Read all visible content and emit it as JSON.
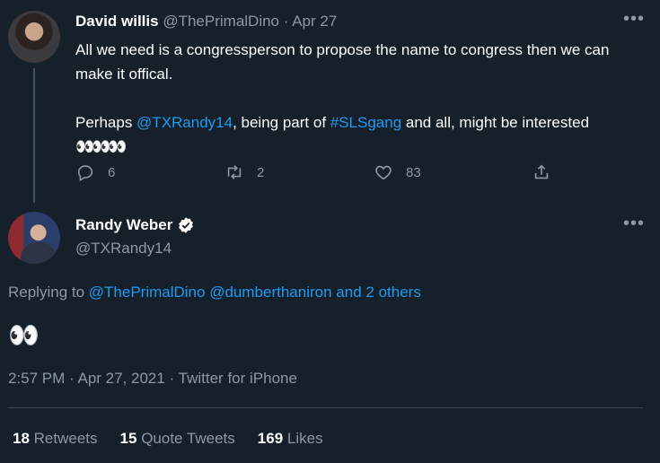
{
  "tweet1": {
    "display_name": "David willis",
    "handle": "@ThePrimalDino",
    "separator": "·",
    "date": "Apr 27",
    "line1": "All we need is a congressperson to propose the name to congress then we can make it offical.",
    "line2_pre": "Perhaps ",
    "line2_mention": "@TXRandy14",
    "line2_mid": ", being part of ",
    "line2_hashtag": "#SLSgang",
    "line2_post": " and all, might be interested",
    "emoji": "👀👀👀",
    "actions": {
      "reply_count": "6",
      "retweet_count": "2",
      "like_count": "83"
    }
  },
  "tweet2": {
    "display_name": "Randy Weber",
    "handle": "@TXRandy14",
    "replying_label": "Replying to ",
    "replying_mention1": "@ThePrimalDino",
    "replying_mention2": "@dumberthaniron",
    "replying_and": "and",
    "replying_others": "2 others",
    "emoji": "👀",
    "time": "2:57 PM",
    "date": "Apr 27, 2021",
    "source": "Twitter for iPhone",
    "stats": {
      "retweets_count": "18",
      "retweets_label": "Retweets",
      "quotes_count": "15",
      "quotes_label": "Quote Tweets",
      "likes_count": "169",
      "likes_label": "Likes"
    }
  },
  "colors": {
    "background": "#15202b",
    "link": "#1d9bf0",
    "muted": "#8b98a5",
    "divider": "#38444d"
  },
  "icons": [
    "reply-icon",
    "retweet-icon",
    "like-icon",
    "share-icon",
    "verified-badge-icon",
    "more-icon"
  ]
}
